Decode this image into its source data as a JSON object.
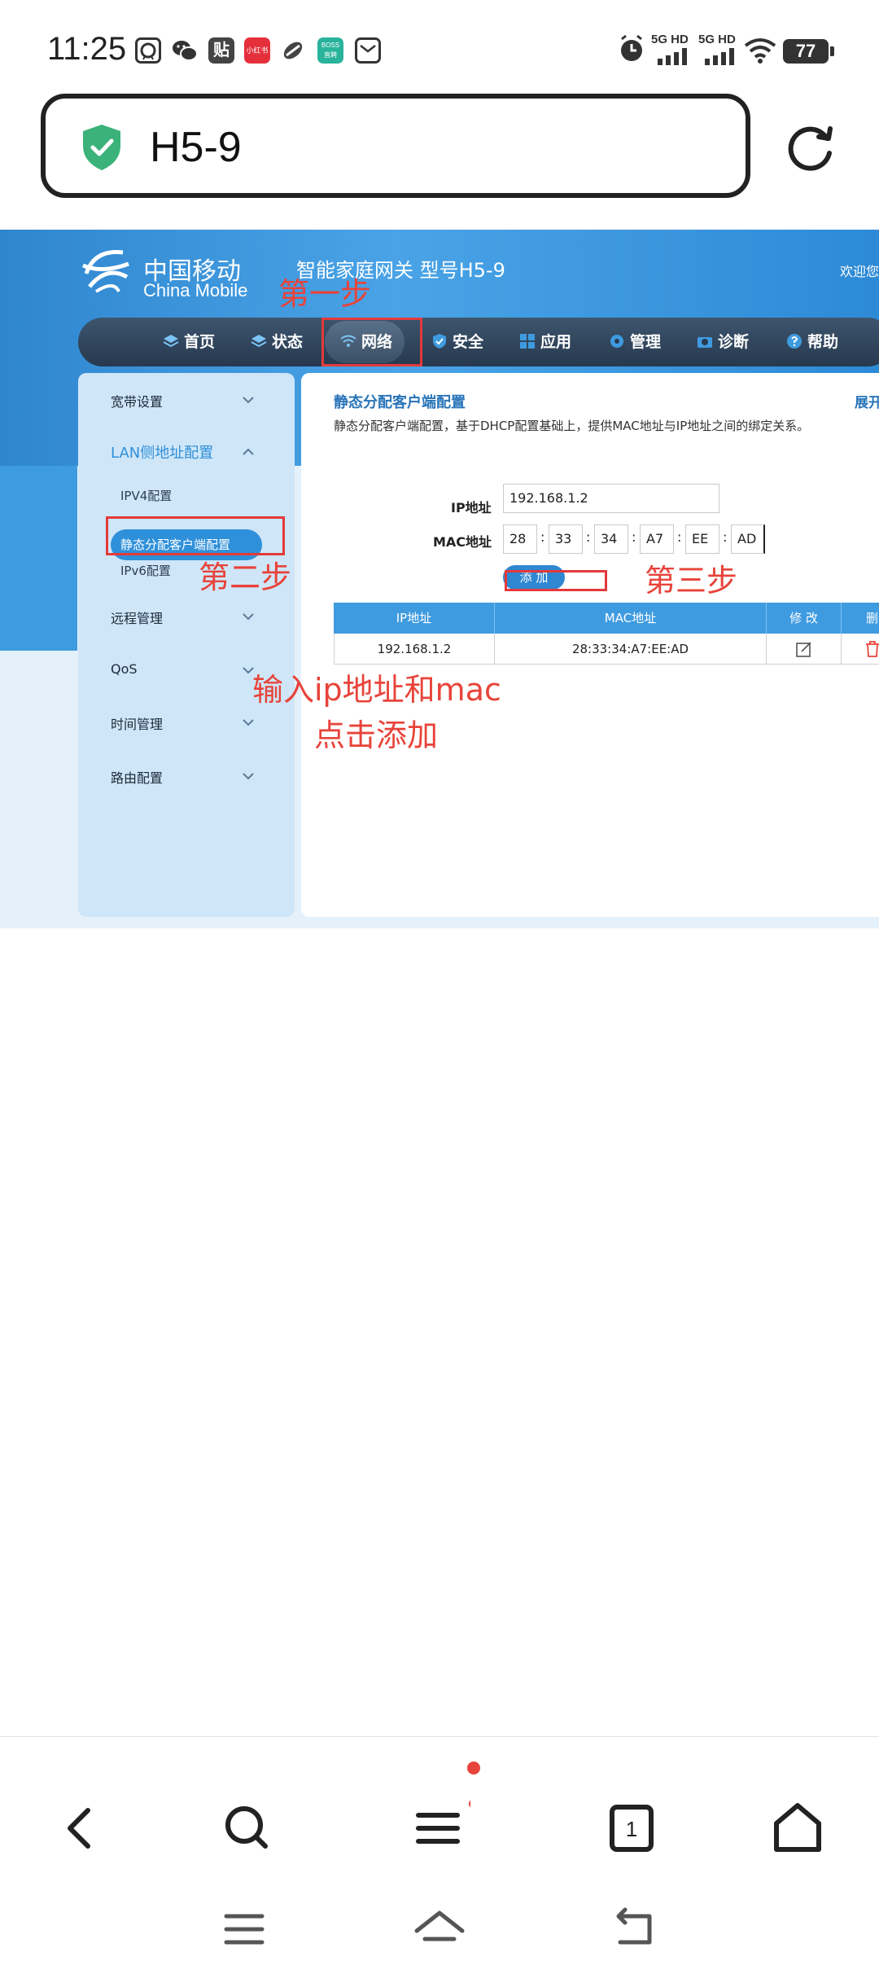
{
  "status_bar": {
    "time": "11:25",
    "notification_icons": [
      "qq-icon",
      "wechat-icon",
      "tieba-icon",
      "xiaohongshu-icon",
      "link-icon",
      "boss-icon",
      "mail-icon"
    ],
    "xiaohongshu_label": "小红书",
    "tieba_label": "贴",
    "boss_label": "BOSS 直聘",
    "sim1_label": "5G HD",
    "sim2_label": "5G HD",
    "battery": "77"
  },
  "url_bar": {
    "url": "H5-9"
  },
  "router_page": {
    "logo_cn": "中国移动",
    "logo_en": "China Mobile",
    "model_text": "智能家庭网关 型号H5-9",
    "welcome": "欢迎您",
    "nav": [
      {
        "label": "首页"
      },
      {
        "label": "状态"
      },
      {
        "label": "网络"
      },
      {
        "label": "安全"
      },
      {
        "label": "应用"
      },
      {
        "label": "管理"
      },
      {
        "label": "诊断"
      },
      {
        "label": "帮助"
      }
    ],
    "sidebar": {
      "broadband": "宽带设置",
      "lan": "LAN侧地址配置",
      "ipv4": "IPV4配置",
      "static_dhcp": "静态分配客户端配置",
      "ipv6": "IPv6配置",
      "remote": "远程管理",
      "qos": "QoS",
      "time": "时间管理",
      "routing": "路由配置"
    },
    "panel": {
      "title": "静态分配客户端配置",
      "expand": "展开",
      "description": "静态分配客户端配置，基于DHCP配置基础上，提供MAC地址与IP地址之间的绑定关系。",
      "ip_label": "IP地址",
      "ip_value": "192.168.1.2",
      "mac_label": "MAC地址",
      "mac_parts": [
        "28",
        "33",
        "34",
        "A7",
        "EE",
        "AD"
      ],
      "add_button": "添 加",
      "table": {
        "headers": [
          "IP地址",
          "MAC地址",
          "修 改",
          "删"
        ],
        "rows": [
          {
            "ip": "192.168.1.2",
            "mac": "28:33:34:A7:EE:AD"
          }
        ]
      }
    }
  },
  "annotations": {
    "step1": "第一步",
    "step2": "第二步",
    "step3": "第三步",
    "instruction_line1": "输入ip地址和mac",
    "instruction_line2": "点击添加",
    "color": "#e8433a"
  },
  "colors": {
    "header_blue": "#3f9be0",
    "nav_dark": "#26394e",
    "secure_green": "#3bb27a"
  }
}
